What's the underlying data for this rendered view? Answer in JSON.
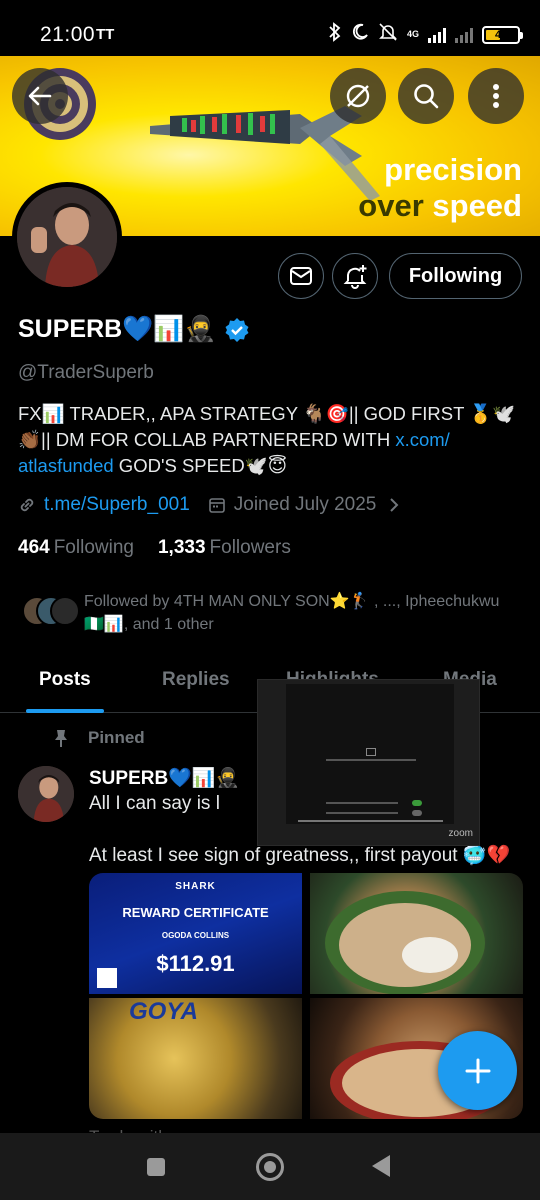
{
  "status_bar": {
    "time": "21:00",
    "carrier_icon": "TT",
    "network": "4G",
    "battery": "41"
  },
  "banner": {
    "line1": "precision",
    "line2_a": "over",
    "line2_b": "speed",
    "accent": "#ffe600"
  },
  "profile": {
    "name": "SUPERB💙📊🥷",
    "handle": "@TraderSuperb",
    "bio_part1": "FX📊 TRADER,, APA STRATEGY 🐐🎯|| GOD FIRST 🥇🕊️👏🏾|| DM FOR COLLAB PARTNERERD WITH ",
    "bio_link": "x.com/atlasfunded",
    "bio_link_display_a": "x.com/",
    "bio_link_display_b": "atlasfunded",
    "bio_part2": "  GOD'S SPEED🕊️😇",
    "website": "t.me/Superb_001",
    "joined": "Joined July 2025",
    "following_count": "464",
    "following_label": "Following",
    "followers_count": "1,333",
    "followers_label": "Followers",
    "followed_by": "Followed by 4TH MAN ONLY SON⭐🏌️ , ..., Ipheechukwu 🇳🇬📊, and 1 other"
  },
  "buttons": {
    "follow": "Following"
  },
  "tabs": [
    {
      "label": "Posts"
    },
    {
      "label": "Replies"
    },
    {
      "label": "Highlights"
    },
    {
      "label": "Media"
    }
  ],
  "post": {
    "pinned_label": "Pinned",
    "author": "SUPERB💙📊🥷",
    "text1": "All I can say is l",
    "text2": "At least I see sign of greatness,, first payout 🥶💔",
    "certificate": {
      "brand": "SHARK",
      "title": "REWARD CERTIFICATE",
      "name": "OGODA COLLINS",
      "amount": "$112.91"
    },
    "image3_text": "GOYA",
    "next_post_preview": "Trade with ..."
  },
  "overlay": {
    "app": "zoom"
  },
  "colors": {
    "accent_blue": "#1d9bf0",
    "muted": "#71767b",
    "background": "#000000"
  }
}
